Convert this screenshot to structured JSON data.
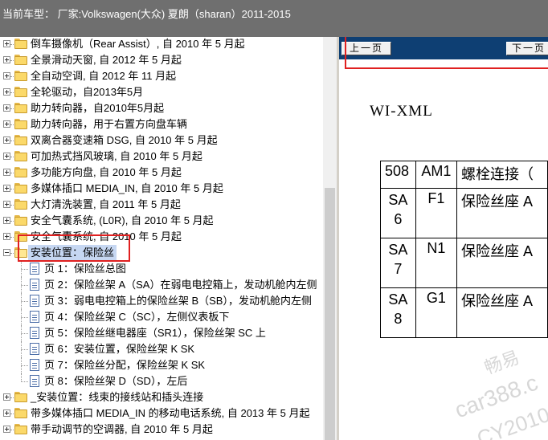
{
  "header": {
    "title": "当前车型：  厂家:Volkswagen(大众) 夏朗（sharan）2011-2015"
  },
  "tree": {
    "items": [
      {
        "label": "倒车摄像机（Rear Assist）, 自 2010 年 5 月起",
        "level": 0,
        "type": "folder"
      },
      {
        "label": "全景滑动天窗, 自 2012 年 5 月起",
        "level": 0,
        "type": "folder"
      },
      {
        "label": "全自动空调, 自 2012 年 11 月起",
        "level": 0,
        "type": "folder"
      },
      {
        "label": "全轮驱动，自2013年5月",
        "level": 0,
        "type": "folder"
      },
      {
        "label": "助力转向器，自2010年5月起",
        "level": 0,
        "type": "folder"
      },
      {
        "label": "助力转向器，用于右置方向盘车辆",
        "level": 0,
        "type": "folder"
      },
      {
        "label": "双离合器变速箱 DSG, 自 2010 年 5 月起",
        "level": 0,
        "type": "folder"
      },
      {
        "label": "可加热式挡风玻璃, 自 2010 年 5 月起",
        "level": 0,
        "type": "folder"
      },
      {
        "label": "多功能方向盘, 自 2010 年 5 月起",
        "level": 0,
        "type": "folder"
      },
      {
        "label": "多媒体插口 MEDIA_IN, 自 2010 年 5 月起",
        "level": 0,
        "type": "folder"
      },
      {
        "label": "大灯清洗装置, 自 2011 年 5 月起",
        "level": 0,
        "type": "folder"
      },
      {
        "label": "安全气囊系统, (L0R), 自 2010 年 5 月起",
        "level": 0,
        "type": "folder"
      },
      {
        "label": "安全气囊系统, 自 2010 年 5 月起",
        "level": 0,
        "type": "folder"
      },
      {
        "label": "安装位置：保险丝",
        "level": 0,
        "type": "folder-open",
        "selected": true
      },
      {
        "label": "页 1：保险丝总图",
        "level": 1,
        "type": "doc"
      },
      {
        "label": "页 2：保险丝架 A（SA）在弱电电控箱上，发动机舱内左侧",
        "level": 1,
        "type": "doc"
      },
      {
        "label": "页 3：弱电电控箱上的保险丝架 B（SB），发动机舱内左侧",
        "level": 1,
        "type": "doc"
      },
      {
        "label": "页 4：保险丝架 C（SC），左侧仪表板下",
        "level": 1,
        "type": "doc"
      },
      {
        "label": "页 5：保险丝继电器座（SR1），保险丝架 SC 上",
        "level": 1,
        "type": "doc"
      },
      {
        "label": "页 6：安装位置，保险丝架 K SK",
        "level": 1,
        "type": "doc"
      },
      {
        "label": "页 7：保险丝分配，保险丝架 K SK",
        "level": 1,
        "type": "doc"
      },
      {
        "label": "页 8：保险丝架 D（SD），左后",
        "level": 1,
        "type": "doc"
      },
      {
        "label": "_安装位置：线束的接线站和插头连接",
        "level": 0,
        "type": "folder"
      },
      {
        "label": "带多媒体插口 MEDIA_IN 的移动电话系统, 自 2013 年 5 月起",
        "level": 0,
        "type": "folder"
      },
      {
        "label": "带手动调节的空调器, 自 2010 年 5 月起",
        "level": 0,
        "type": "folder"
      }
    ]
  },
  "viewer": {
    "prev_label": "上一页",
    "next_label": "下一页",
    "doc_heading": "WI-XML",
    "table": [
      [
        "508",
        "AM1",
        "螺栓连接（"
      ],
      [
        "SA 6",
        "F1",
        "保险丝座 A"
      ],
      [
        "SA 7",
        "N1",
        "保险丝座 A"
      ],
      [
        "SA 8",
        "G1",
        "保险丝座 A"
      ]
    ],
    "watermark": [
      "畅易",
      "car388.c",
      "CY2010"
    ]
  },
  "colors": {
    "header_bg": "#6f6f6f",
    "nav_bg": "#0e3f73",
    "highlight_red": "#e02020",
    "selection": "#c6d7f2"
  }
}
